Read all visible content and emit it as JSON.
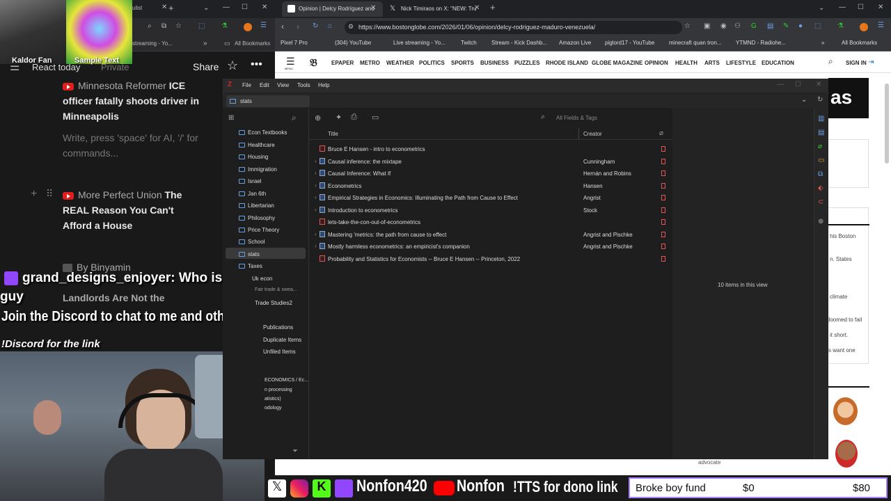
{
  "left_app": {
    "header_title": "React today",
    "privacy": "Private",
    "share_label": "Share",
    "note1": {
      "source": "Minnesota Reformer",
      "title": "ICE officer fatally shoots driver in Minneapolis"
    },
    "placeholder": "Write, press 'space' for AI, '/' for commands...",
    "note2": {
      "source": "More Perfect Union",
      "title": "The REAL Reason You Can't Afford a House"
    },
    "note3_partial": "By Binyamin",
    "bookmarks": {
      "item1": "streaming - Yo...",
      "all": "All Bookmarks"
    }
  },
  "overlays": {
    "cam1_name": "Kaldor Fan",
    "cam2_name": "Sample Text",
    "chat_user": "grand_designs_enjoyer:",
    "chat_message": "Who is the vc guy",
    "discord_line1": "Join the Discord to chat to me and other fans!",
    "discord_line2": "!Discord for the link",
    "behind_chat_text": "Landlords Are Not the"
  },
  "browser": {
    "tabs": [
      {
        "label": "Opinion | Delcy Rodríguez and"
      },
      {
        "label": "Nick Timiraos on X: \"NEW: Tru"
      }
    ],
    "url": "https://www.bostonglobe.com/2026/01/06/opinion/delcy-rodriguez-maduro-venezuela/",
    "bookmarks": [
      "Pixel 7 Pro",
      "(304) YouTube",
      "Live streaming - Yo...",
      "Twitch",
      "Stream - Kick Dashb...",
      "Amazon Live",
      "piglord17 - YouTube",
      "minecraft quan tron...",
      "YTMND - Radiohe..."
    ],
    "all_bookmarks": "All Bookmarks"
  },
  "globe_nav": {
    "items": [
      "EPAPER",
      "METRO",
      "WEATHER",
      "POLITICS",
      "SPORTS",
      "BUSINESS",
      "PUZZLES",
      "RHODE ISLAND",
      "GLOBE MAGAZINE",
      "OPINION",
      "HEALTH",
      "ARTS",
      "LIFESTYLE",
      "EDUCATION"
    ],
    "signin": "SIGN IN",
    "menu": "MENU",
    "side_texts": [
      "his Boston",
      "n. States",
      "climate",
      "doomed to fail",
      "it short.",
      "s want one",
      "advocate"
    ],
    "dark_box_text": "as"
  },
  "zotero": {
    "menu": [
      "File",
      "Edit",
      "View",
      "Tools",
      "Help"
    ],
    "current_tab": "stats",
    "search_placeholder": "All Fields & Tags",
    "col_title": "Title",
    "col_creator": "Creator",
    "collections": [
      "Econ Textbooks",
      "Healthcare",
      "Housing",
      "Immigration",
      "Israel",
      "Jan 6th",
      "Libertarian",
      "Philosophy",
      "Price Theory",
      "School",
      "stats",
      "Taxes",
      "Uk econ",
      "Fair trade & swea...",
      "Trade Studies2",
      "...",
      "Publications",
      "Duplicate Items",
      "Unfiled Items"
    ],
    "lower_collections": [
      "ECONOMICS / Ec...",
      "n processing",
      "atistics)",
      "odology"
    ],
    "items": [
      {
        "title": "Bruce E Hansen - intro to econometrics",
        "creator": "",
        "type": "pdf",
        "expand": false
      },
      {
        "title": "Causal inference: the mixtape",
        "creator": "Cunningham",
        "type": "book",
        "expand": true
      },
      {
        "title": "Causal Inference: What If",
        "creator": "Hernán and Robins",
        "type": "book",
        "expand": true
      },
      {
        "title": "Econometrics",
        "creator": "Hansen",
        "type": "book",
        "expand": true
      },
      {
        "title": "Empirical Strategies in Economics: Illuminating the Path from Cause to Effect",
        "creator": "Angrist",
        "type": "book",
        "expand": true
      },
      {
        "title": "Introduction to econometrics",
        "creator": "Stock",
        "type": "book",
        "expand": true
      },
      {
        "title": "lets-take-the-con-out-of-econometrics",
        "creator": "",
        "type": "pdf",
        "expand": false
      },
      {
        "title": "Mastering 'metrics: the path from cause to effect",
        "creator": "Angrist and Pischke",
        "type": "book",
        "expand": true
      },
      {
        "title": "Mostly harmless econometrics: an empiricist's companion",
        "creator": "Angrist and Pischke",
        "type": "book",
        "expand": true
      },
      {
        "title": "Probability and Statistics for Economists -- Bruce E Hansen -- Princeton, 2022",
        "creator": "",
        "type": "pdf",
        "expand": false
      }
    ],
    "items_count": "10 items in this view"
  },
  "stream_bar": {
    "handle1": "Nonfon420",
    "handle2": "Nonfon",
    "tts": "!TTS for dono link",
    "fund_label": "Broke boy fund",
    "fund_current": "$0",
    "fund_goal": "$80",
    "fund_progress": 0
  }
}
